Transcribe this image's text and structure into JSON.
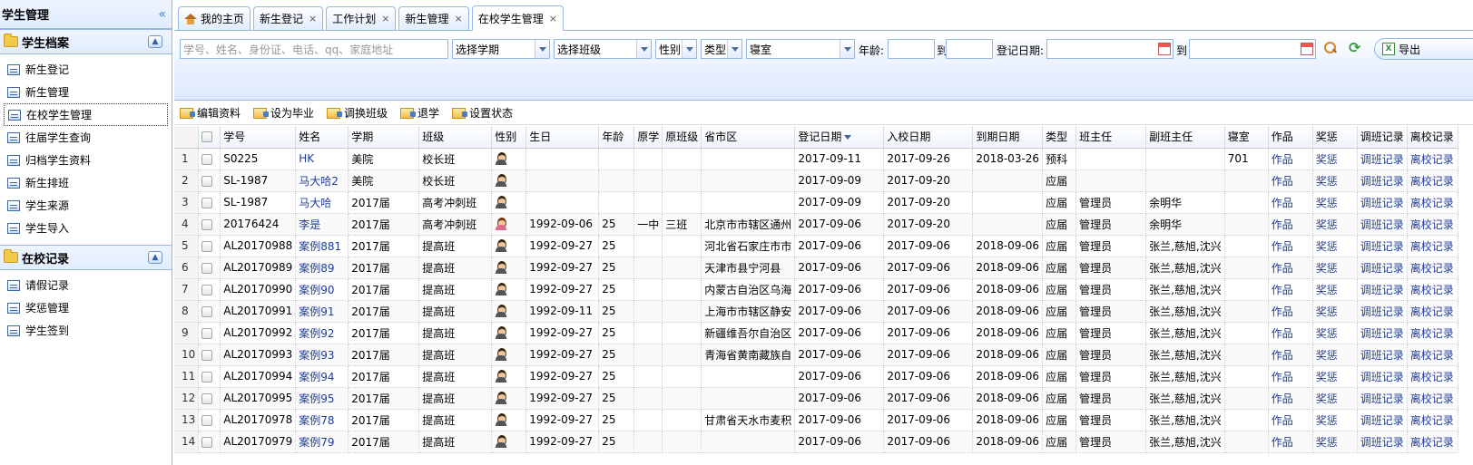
{
  "sidebar": {
    "title": "学生管理",
    "collapse_glyph": "«",
    "groups": [
      {
        "label": "学生档案",
        "items": [
          {
            "label": "新生登记"
          },
          {
            "label": "新生管理"
          },
          {
            "label": "在校学生管理",
            "selected": true
          },
          {
            "label": "往届学生查询"
          },
          {
            "label": "归档学生资料"
          },
          {
            "label": "新生排班"
          },
          {
            "label": "学生来源"
          },
          {
            "label": "学生导入"
          }
        ]
      },
      {
        "label": "在校记录",
        "items": [
          {
            "label": "请假记录"
          },
          {
            "label": "奖惩管理"
          },
          {
            "label": "学生签到"
          }
        ]
      }
    ]
  },
  "tabs": [
    {
      "label": "我的主页",
      "home": true,
      "closable": false
    },
    {
      "label": "新生登记",
      "closable": true
    },
    {
      "label": "工作计划",
      "closable": true
    },
    {
      "label": "新生管理",
      "closable": true
    },
    {
      "label": "在校学生管理",
      "closable": true,
      "active": true
    }
  ],
  "filters": {
    "keyword_placeholder": "学号、姓名、身份证、电话、qq、家庭地址",
    "term": "选择学期",
    "class": "选择班级",
    "gender": "性别",
    "type": "类型",
    "dorm": "寝室",
    "age_label": "年龄:",
    "to_label": "到",
    "reg_date_label": "登记日期:",
    "to_label2": "到",
    "export_label": "导出"
  },
  "actions": [
    {
      "label": "编辑资料"
    },
    {
      "label": "设为毕业"
    },
    {
      "label": "调换班级"
    },
    {
      "label": "退学"
    },
    {
      "label": "设置状态"
    }
  ],
  "table": {
    "columns": [
      "",
      "",
      "学号",
      "姓名",
      "学期",
      "班级",
      "性别",
      "生日",
      "年龄",
      "原学",
      "原班级",
      "省市区",
      "登记日期",
      "入校日期",
      "到期日期",
      "类型",
      "班主任",
      "副班主任",
      "寝室",
      "作品",
      "奖惩",
      "调班记录",
      "离校记录"
    ],
    "sort_column": "登记日期",
    "rows": [
      {
        "n": "1",
        "id": "S0225",
        "name": "HK",
        "term": "美院",
        "class": "校长班",
        "sex": "m",
        "birthday": "",
        "age": "",
        "school": "",
        "oldclass": "",
        "region": "",
        "reg": "2017-09-11",
        "enter": "2017-09-26",
        "expire": "2018-03-26",
        "type": "预科",
        "teacher": "",
        "vteacher": "",
        "dorm": "701",
        "works": "作品",
        "award": "奖惩",
        "transfer": "调班记录",
        "leave": "离校记录"
      },
      {
        "n": "2",
        "id": "SL-1987",
        "name": "马大哈2",
        "term": "美院",
        "class": "校长班",
        "sex": "m",
        "birthday": "",
        "age": "",
        "school": "",
        "oldclass": "",
        "region": "",
        "reg": "2017-09-09",
        "enter": "2017-09-20",
        "expire": "",
        "type": "应届",
        "teacher": "",
        "vteacher": "",
        "dorm": "",
        "works": "作品",
        "award": "奖惩",
        "transfer": "调班记录",
        "leave": "离校记录"
      },
      {
        "n": "3",
        "id": "SL-1987",
        "name": "马大哈",
        "term": "2017届",
        "class": "高考冲刺班",
        "sex": "m",
        "birthday": "",
        "age": "",
        "school": "",
        "oldclass": "",
        "region": "",
        "reg": "2017-09-09",
        "enter": "2017-09-20",
        "expire": "",
        "type": "应届",
        "teacher": "管理员",
        "vteacher": "余明华",
        "dorm": "",
        "works": "作品",
        "award": "奖惩",
        "transfer": "调班记录",
        "leave": "离校记录"
      },
      {
        "n": "4",
        "id": "20176424",
        "name": "李是",
        "term": "2017届",
        "class": "高考冲刺班",
        "sex": "f",
        "birthday": "1992-09-06",
        "age": "25",
        "school": "一中",
        "oldclass": "三班",
        "region": "北京市市辖区通州",
        "reg": "2017-09-06",
        "enter": "2017-09-20",
        "expire": "",
        "type": "应届",
        "teacher": "管理员",
        "vteacher": "余明华",
        "dorm": "",
        "works": "作品",
        "award": "奖惩",
        "transfer": "调班记录",
        "leave": "离校记录"
      },
      {
        "n": "5",
        "id": "AL20170988",
        "name": "案例881",
        "term": "2017届",
        "class": "提高班",
        "sex": "m",
        "birthday": "1992-09-27",
        "age": "25",
        "school": "",
        "oldclass": "",
        "region": "河北省石家庄市市",
        "reg": "2017-09-06",
        "enter": "2017-09-06",
        "expire": "2018-09-06",
        "type": "应届",
        "teacher": "管理员",
        "vteacher": "张兰,慈旭,沈兴",
        "dorm": "",
        "works": "作品",
        "award": "奖惩",
        "transfer": "调班记录",
        "leave": "离校记录"
      },
      {
        "n": "6",
        "id": "AL20170989",
        "name": "案例89",
        "term": "2017届",
        "class": "提高班",
        "sex": "m",
        "birthday": "1992-09-27",
        "age": "25",
        "school": "",
        "oldclass": "",
        "region": "天津市县宁河县",
        "reg": "2017-09-06",
        "enter": "2017-09-06",
        "expire": "2018-09-06",
        "type": "应届",
        "teacher": "管理员",
        "vteacher": "张兰,慈旭,沈兴",
        "dorm": "",
        "works": "作品",
        "award": "奖惩",
        "transfer": "调班记录",
        "leave": "离校记录"
      },
      {
        "n": "7",
        "id": "AL20170990",
        "name": "案例90",
        "term": "2017届",
        "class": "提高班",
        "sex": "m",
        "birthday": "1992-09-27",
        "age": "25",
        "school": "",
        "oldclass": "",
        "region": "内蒙古自治区乌海",
        "reg": "2017-09-06",
        "enter": "2017-09-06",
        "expire": "2018-09-06",
        "type": "应届",
        "teacher": "管理员",
        "vteacher": "张兰,慈旭,沈兴",
        "dorm": "",
        "works": "作品",
        "award": "奖惩",
        "transfer": "调班记录",
        "leave": "离校记录"
      },
      {
        "n": "8",
        "id": "AL20170991",
        "name": "案例91",
        "term": "2017届",
        "class": "提高班",
        "sex": "m",
        "birthday": "1992-09-11",
        "age": "25",
        "school": "",
        "oldclass": "",
        "region": "上海市市辖区静安",
        "reg": "2017-09-06",
        "enter": "2017-09-06",
        "expire": "2018-09-06",
        "type": "应届",
        "teacher": "管理员",
        "vteacher": "张兰,慈旭,沈兴",
        "dorm": "",
        "works": "作品",
        "award": "奖惩",
        "transfer": "调班记录",
        "leave": "离校记录"
      },
      {
        "n": "9",
        "id": "AL20170992",
        "name": "案例92",
        "term": "2017届",
        "class": "提高班",
        "sex": "m",
        "birthday": "1992-09-27",
        "age": "25",
        "school": "",
        "oldclass": "",
        "region": "新疆维吾尔自治区",
        "reg": "2017-09-06",
        "enter": "2017-09-06",
        "expire": "2018-09-06",
        "type": "应届",
        "teacher": "管理员",
        "vteacher": "张兰,慈旭,沈兴",
        "dorm": "",
        "works": "作品",
        "award": "奖惩",
        "transfer": "调班记录",
        "leave": "离校记录"
      },
      {
        "n": "10",
        "id": "AL20170993",
        "name": "案例93",
        "term": "2017届",
        "class": "提高班",
        "sex": "m",
        "birthday": "1992-09-27",
        "age": "25",
        "school": "",
        "oldclass": "",
        "region": "青海省黄南藏族自",
        "reg": "2017-09-06",
        "enter": "2017-09-06",
        "expire": "2018-09-06",
        "type": "应届",
        "teacher": "管理员",
        "vteacher": "张兰,慈旭,沈兴",
        "dorm": "",
        "works": "作品",
        "award": "奖惩",
        "transfer": "调班记录",
        "leave": "离校记录"
      },
      {
        "n": "11",
        "id": "AL20170994",
        "name": "案例94",
        "term": "2017届",
        "class": "提高班",
        "sex": "m",
        "birthday": "1992-09-27",
        "age": "25",
        "school": "",
        "oldclass": "",
        "region": "",
        "reg": "2017-09-06",
        "enter": "2017-09-06",
        "expire": "2018-09-06",
        "type": "应届",
        "teacher": "管理员",
        "vteacher": "张兰,慈旭,沈兴",
        "dorm": "",
        "works": "作品",
        "award": "奖惩",
        "transfer": "调班记录",
        "leave": "离校记录"
      },
      {
        "n": "12",
        "id": "AL20170995",
        "name": "案例95",
        "term": "2017届",
        "class": "提高班",
        "sex": "m",
        "birthday": "1992-09-27",
        "age": "25",
        "school": "",
        "oldclass": "",
        "region": "",
        "reg": "2017-09-06",
        "enter": "2017-09-06",
        "expire": "2018-09-06",
        "type": "应届",
        "teacher": "管理员",
        "vteacher": "张兰,慈旭,沈兴",
        "dorm": "",
        "works": "作品",
        "award": "奖惩",
        "transfer": "调班记录",
        "leave": "离校记录"
      },
      {
        "n": "13",
        "id": "AL20170978",
        "name": "案例78",
        "term": "2017届",
        "class": "提高班",
        "sex": "m",
        "birthday": "1992-09-27",
        "age": "25",
        "school": "",
        "oldclass": "",
        "region": "甘肃省天水市麦积",
        "reg": "2017-09-06",
        "enter": "2017-09-06",
        "expire": "2018-09-06",
        "type": "应届",
        "teacher": "管理员",
        "vteacher": "张兰,慈旭,沈兴",
        "dorm": "",
        "works": "作品",
        "award": "奖惩",
        "transfer": "调班记录",
        "leave": "离校记录"
      },
      {
        "n": "14",
        "id": "AL20170979",
        "name": "案例79",
        "term": "2017届",
        "class": "提高班",
        "sex": "m",
        "birthday": "1992-09-27",
        "age": "25",
        "school": "",
        "oldclass": "",
        "region": "",
        "reg": "2017-09-06",
        "enter": "2017-09-06",
        "expire": "2018-09-06",
        "type": "应届",
        "teacher": "管理员",
        "vteacher": "张兰,慈旭,沈兴",
        "dorm": "",
        "works": "作品",
        "award": "奖惩",
        "transfer": "调班记录",
        "leave": "离校记录"
      }
    ]
  }
}
